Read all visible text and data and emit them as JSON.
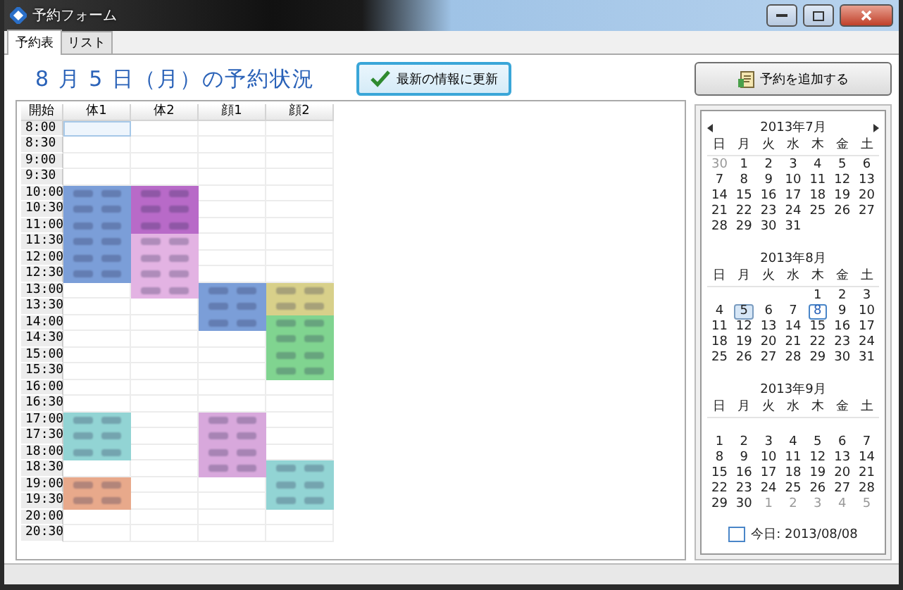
{
  "window": {
    "title": "予約フォーム"
  },
  "tabs": [
    {
      "label": "予約表",
      "selected": true
    },
    {
      "label": "リスト",
      "selected": false
    }
  ],
  "heading": "8 月 5 日（月）の予約状況",
  "refresh_button": {
    "label": "最新の情報に更新"
  },
  "add_button": {
    "label": "予約を追加する"
  },
  "schedule": {
    "columns": [
      "開始",
      "体1",
      "体2",
      "顔1",
      "顔2"
    ],
    "rows": [
      {
        "time": "8:00",
        "cells": [
          {
            "booked": false,
            "selected": true
          },
          {
            "booked": false,
            "selected": false
          },
          {
            "booked": false,
            "selected": false
          },
          {
            "booked": false,
            "selected": false
          }
        ]
      },
      {
        "time": "8:30",
        "cells": [
          {
            "booked": false,
            "selected": false
          },
          {
            "booked": false,
            "selected": false
          },
          {
            "booked": false,
            "selected": false
          },
          {
            "booked": false,
            "selected": false
          }
        ]
      },
      {
        "time": "9:00",
        "cells": [
          {
            "booked": false,
            "selected": false
          },
          {
            "booked": false,
            "selected": false
          },
          {
            "booked": false,
            "selected": false
          },
          {
            "booked": false,
            "selected": false
          }
        ]
      },
      {
        "time": "9:30",
        "cells": [
          {
            "booked": false,
            "selected": false
          },
          {
            "booked": false,
            "selected": false
          },
          {
            "booked": false,
            "selected": false
          },
          {
            "booked": false,
            "selected": false
          }
        ]
      },
      {
        "time": "10:00",
        "cells": [
          {
            "booked": true,
            "color": "#7b9ed8",
            "selected": false
          },
          {
            "booked": true,
            "color": "#b86ac8",
            "selected": false
          },
          {
            "booked": false,
            "selected": false
          },
          {
            "booked": false,
            "selected": false
          }
        ]
      },
      {
        "time": "10:30",
        "cells": [
          {
            "booked": true,
            "color": "#7b9ed8",
            "selected": false
          },
          {
            "booked": true,
            "color": "#b86ac8",
            "selected": false
          },
          {
            "booked": false,
            "selected": false
          },
          {
            "booked": false,
            "selected": false
          }
        ]
      },
      {
        "time": "11:00",
        "cells": [
          {
            "booked": true,
            "color": "#7b9ed8",
            "selected": false
          },
          {
            "booked": true,
            "color": "#b86ac8",
            "selected": false
          },
          {
            "booked": false,
            "selected": false
          },
          {
            "booked": false,
            "selected": false
          }
        ]
      },
      {
        "time": "11:30",
        "cells": [
          {
            "booked": true,
            "color": "#7b9ed8",
            "selected": false
          },
          {
            "booked": true,
            "color": "#e3b3e3",
            "selected": false
          },
          {
            "booked": false,
            "selected": false
          },
          {
            "booked": false,
            "selected": false
          }
        ]
      },
      {
        "time": "12:00",
        "cells": [
          {
            "booked": true,
            "color": "#7b9ed8",
            "selected": false
          },
          {
            "booked": true,
            "color": "#e3b3e3",
            "selected": false
          },
          {
            "booked": false,
            "selected": false
          },
          {
            "booked": false,
            "selected": false
          }
        ]
      },
      {
        "time": "12:30",
        "cells": [
          {
            "booked": true,
            "color": "#7b9ed8",
            "selected": false
          },
          {
            "booked": true,
            "color": "#e3b3e3",
            "selected": false
          },
          {
            "booked": false,
            "selected": false
          },
          {
            "booked": false,
            "selected": false
          }
        ]
      },
      {
        "time": "13:00",
        "cells": [
          {
            "booked": false,
            "selected": false
          },
          {
            "booked": true,
            "color": "#e3b3e3",
            "selected": false
          },
          {
            "booked": true,
            "color": "#7b9ed8",
            "selected": false
          },
          {
            "booked": true,
            "color": "#d8d08a",
            "selected": false
          }
        ]
      },
      {
        "time": "13:30",
        "cells": [
          {
            "booked": false,
            "selected": false
          },
          {
            "booked": false,
            "selected": false
          },
          {
            "booked": true,
            "color": "#7b9ed8",
            "selected": false
          },
          {
            "booked": true,
            "color": "#d8d08a",
            "selected": false
          }
        ]
      },
      {
        "time": "14:00",
        "cells": [
          {
            "booked": false,
            "selected": false
          },
          {
            "booked": false,
            "selected": false
          },
          {
            "booked": true,
            "color": "#7b9ed8",
            "selected": false
          },
          {
            "booked": true,
            "color": "#80d490",
            "selected": false
          }
        ]
      },
      {
        "time": "14:30",
        "cells": [
          {
            "booked": false,
            "selected": false
          },
          {
            "booked": false,
            "selected": false
          },
          {
            "booked": false,
            "selected": false
          },
          {
            "booked": true,
            "color": "#80d490",
            "selected": false
          }
        ]
      },
      {
        "time": "15:00",
        "cells": [
          {
            "booked": false,
            "selected": false
          },
          {
            "booked": false,
            "selected": false
          },
          {
            "booked": false,
            "selected": false
          },
          {
            "booked": true,
            "color": "#80d490",
            "selected": false
          }
        ]
      },
      {
        "time": "15:30",
        "cells": [
          {
            "booked": false,
            "selected": false
          },
          {
            "booked": false,
            "selected": false
          },
          {
            "booked": false,
            "selected": false
          },
          {
            "booked": true,
            "color": "#80d490",
            "selected": false
          }
        ]
      },
      {
        "time": "16:00",
        "cells": [
          {
            "booked": false,
            "selected": false
          },
          {
            "booked": false,
            "selected": false
          },
          {
            "booked": false,
            "selected": false
          },
          {
            "booked": false,
            "selected": false
          }
        ]
      },
      {
        "time": "16:30",
        "cells": [
          {
            "booked": false,
            "selected": false
          },
          {
            "booked": false,
            "selected": false
          },
          {
            "booked": false,
            "selected": false
          },
          {
            "booked": false,
            "selected": false
          }
        ]
      },
      {
        "time": "17:00",
        "cells": [
          {
            "booked": true,
            "color": "#92d4d4",
            "selected": false
          },
          {
            "booked": false,
            "selected": false
          },
          {
            "booked": true,
            "color": "#d8a8dc",
            "selected": false
          },
          {
            "booked": false,
            "selected": false
          }
        ]
      },
      {
        "time": "17:30",
        "cells": [
          {
            "booked": true,
            "color": "#92d4d4",
            "selected": false
          },
          {
            "booked": false,
            "selected": false
          },
          {
            "booked": true,
            "color": "#d8a8dc",
            "selected": false
          },
          {
            "booked": false,
            "selected": false
          }
        ]
      },
      {
        "time": "18:00",
        "cells": [
          {
            "booked": true,
            "color": "#92d4d4",
            "selected": false
          },
          {
            "booked": false,
            "selected": false
          },
          {
            "booked": true,
            "color": "#d8a8dc",
            "selected": false
          },
          {
            "booked": false,
            "selected": false
          }
        ]
      },
      {
        "time": "18:30",
        "cells": [
          {
            "booked": false,
            "selected": false
          },
          {
            "booked": false,
            "selected": false
          },
          {
            "booked": true,
            "color": "#d8a8dc",
            "selected": false
          },
          {
            "booked": true,
            "color": "#92d4d4",
            "selected": false
          }
        ]
      },
      {
        "time": "19:00",
        "cells": [
          {
            "booked": true,
            "color": "#e8a98b",
            "selected": false
          },
          {
            "booked": false,
            "selected": false
          },
          {
            "booked": false,
            "selected": false
          },
          {
            "booked": true,
            "color": "#92d4d4",
            "selected": false
          }
        ]
      },
      {
        "time": "19:30",
        "cells": [
          {
            "booked": true,
            "color": "#e8a98b",
            "selected": false
          },
          {
            "booked": false,
            "selected": false
          },
          {
            "booked": false,
            "selected": false
          },
          {
            "booked": true,
            "color": "#92d4d4",
            "selected": false
          }
        ]
      },
      {
        "time": "20:00",
        "cells": [
          {
            "booked": false,
            "selected": false
          },
          {
            "booked": false,
            "selected": false
          },
          {
            "booked": false,
            "selected": false
          },
          {
            "booked": false,
            "selected": false
          }
        ]
      },
      {
        "time": "20:30",
        "cells": [
          {
            "booked": false,
            "selected": false
          },
          {
            "booked": false,
            "selected": false
          },
          {
            "booked": false,
            "selected": false
          },
          {
            "booked": false,
            "selected": false
          }
        ]
      }
    ]
  },
  "calendar": {
    "months": [
      {
        "title": "2013年7月",
        "weekdays": [
          "日",
          "月",
          "火",
          "水",
          "木",
          "金",
          "土"
        ],
        "blank_first_row": false,
        "weeks": [
          [
            {
              "day": "30",
              "other_month": true
            },
            "1",
            "2",
            "3",
            "4",
            "5",
            "6"
          ],
          [
            "7",
            "8",
            "9",
            "10",
            "11",
            "12",
            "13"
          ],
          [
            "14",
            "15",
            "16",
            "17",
            "18",
            "19",
            "20"
          ],
          [
            "21",
            "22",
            "23",
            "24",
            "25",
            "26",
            "27"
          ],
          [
            "28",
            "29",
            "30",
            "31"
          ]
        ]
      },
      {
        "title": "2013年8月",
        "weekdays": [
          "日",
          "月",
          "火",
          "水",
          "木",
          "金",
          "土"
        ],
        "blank_first_row": false,
        "weeks": [
          [
            "1",
            "2",
            "3"
          ],
          [
            "4",
            {
              "day": "5",
              "selected": true
            },
            "6",
            "7",
            {
              "day": "8",
              "today": true
            },
            "9",
            "10"
          ],
          [
            "11",
            "12",
            "13",
            "14",
            "15",
            "16",
            "17"
          ],
          [
            "18",
            "19",
            "20",
            "21",
            "22",
            "23",
            "24"
          ],
          [
            "25",
            "26",
            "27",
            "28",
            "29",
            "30",
            "31"
          ]
        ]
      },
      {
        "title": "2013年9月",
        "weekdays": [
          "日",
          "月",
          "火",
          "水",
          "木",
          "金",
          "土"
        ],
        "blank_first_row": true,
        "weeks": [
          [
            "1",
            "2",
            "3",
            "4",
            "5",
            "6",
            "7"
          ],
          [
            "8",
            "9",
            "10",
            "11",
            "12",
            "13",
            "14"
          ],
          [
            "15",
            "16",
            "17",
            "18",
            "19",
            "20",
            "21"
          ],
          [
            "22",
            "23",
            "24",
            "25",
            "26",
            "27",
            "28"
          ],
          [
            "29",
            "30",
            {
              "day": "1",
              "other_month": true
            },
            {
              "day": "2",
              "other_month": true
            },
            {
              "day": "3",
              "other_month": true
            },
            {
              "day": "4",
              "other_month": true
            },
            {
              "day": "5",
              "other_month": true
            }
          ]
        ]
      }
    ],
    "today_label": "今日: 2013/08/08"
  }
}
